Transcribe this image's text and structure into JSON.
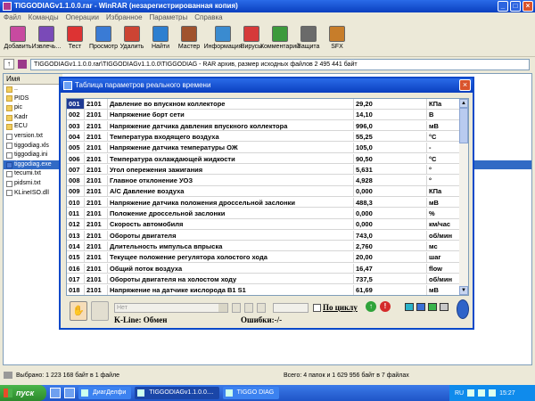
{
  "winrar": {
    "title": "TIGGODIAGv1.1.0.0.rar - WinRAR (незарегистрированная копия)",
    "menu": [
      "Файл",
      "Команды",
      "Операции",
      "Избранное",
      "Параметры",
      "Справка"
    ],
    "toolbar": [
      "Добавить",
      "Извлечь...",
      "Тест",
      "Просмотр",
      "Удалить",
      "Найти",
      "Мастер",
      "Информация",
      "Вирусы",
      "Комментарий",
      "Защита",
      "SFX"
    ],
    "address": "TIGGODIAGv1.1.0.0.rar\\TIGGODIAGv1.1.0.0\\TIGGODIAG - RAR архив, размер исходных файлов 2 495 441 байт",
    "files_header": "Имя",
    "files": [
      {
        "name": "..",
        "type": "folder"
      },
      {
        "name": "PIDS",
        "type": "folder"
      },
      {
        "name": "pic",
        "type": "folder"
      },
      {
        "name": "Kadr",
        "type": "folder"
      },
      {
        "name": "ECU",
        "type": "folder"
      },
      {
        "name": "version.txt",
        "type": "doc"
      },
      {
        "name": "tiggodiag.xls",
        "type": "doc"
      },
      {
        "name": "tiggodiag.ini",
        "type": "doc"
      },
      {
        "name": "tiggodiag.exe",
        "type": "exe",
        "selected": true
      },
      {
        "name": "tecumi.txt",
        "type": "doc"
      },
      {
        "name": "pidsmi.txt",
        "type": "doc"
      },
      {
        "name": "KLineISO.dll",
        "type": "doc"
      }
    ],
    "status_left": "Выбрано: 1 223 168 байт в 1 файле",
    "status_right": "Всего: 4 папок и 1 629 956 байт в 7 файлах"
  },
  "dialog": {
    "title": "Таблица параметров реального времени",
    "rows": [
      {
        "n": "001",
        "code": "2101",
        "name": "Давление во впускном коллекторе",
        "value": "29,20",
        "unit": "КПа"
      },
      {
        "n": "002",
        "code": "2101",
        "name": "Напряжение борт сети",
        "value": "14,10",
        "unit": "В"
      },
      {
        "n": "003",
        "code": "2101",
        "name": "Напряжение датчика давления впускного коллектора",
        "value": "996,0",
        "unit": "мВ"
      },
      {
        "n": "004",
        "code": "2101",
        "name": "Температура входящего воздуха",
        "value": "55,25",
        "unit": "°C"
      },
      {
        "n": "005",
        "code": "2101",
        "name": "Напряжение датчика температуры ОЖ",
        "value": "105,0",
        "unit": "-"
      },
      {
        "n": "006",
        "code": "2101",
        "name": "Температура охлаждающей жидкости",
        "value": "90,50",
        "unit": "°C"
      },
      {
        "n": "007",
        "code": "2101",
        "name": "Угол опережения зажигания",
        "value": "5,631",
        "unit": "°"
      },
      {
        "n": "008",
        "code": "2101",
        "name": "Главное отклонение УОЗ",
        "value": "4,928",
        "unit": "°"
      },
      {
        "n": "009",
        "code": "2101",
        "name": "А/С Давление воздуха",
        "value": "0,000",
        "unit": "КПа"
      },
      {
        "n": "010",
        "code": "2101",
        "name": "Напряжение датчика положения дроссельной заслонки",
        "value": "488,3",
        "unit": "мВ"
      },
      {
        "n": "011",
        "code": "2101",
        "name": "Положение дроссельной заслонки",
        "value": "0,000",
        "unit": "%"
      },
      {
        "n": "012",
        "code": "2101",
        "name": "Скорость автомобиля",
        "value": "0,000",
        "unit": "км/час"
      },
      {
        "n": "013",
        "code": "2101",
        "name": "Обороты двигателя",
        "value": "743,0",
        "unit": "об/мин"
      },
      {
        "n": "014",
        "code": "2101",
        "name": "Длительность импульса впрыска",
        "value": "2,760",
        "unit": "мс"
      },
      {
        "n": "015",
        "code": "2101",
        "name": "Текущее положение регулятора холостого хода",
        "value": "20,00",
        "unit": "шаг"
      },
      {
        "n": "016",
        "code": "2101",
        "name": "Общий поток воздуха",
        "value": "16,47",
        "unit": "flow"
      },
      {
        "n": "017",
        "code": "2101",
        "name": "Обороты двигателя на холостом ходу",
        "value": "737,5",
        "unit": "об/мин"
      },
      {
        "n": "018",
        "code": "2101",
        "name": "Напряжение на датчике кислорода B1 S1",
        "value": "61,69",
        "unit": "мВ"
      }
    ],
    "combo_value": "Нет",
    "cycle_label": "По циклу",
    "kline_label": "K-Line: Обмен",
    "errors_label": "Ошибки:-/-"
  },
  "taskbar": {
    "start_label": "пуск",
    "buttons": [
      "ДиагДелфи",
      "TIGGODIAGv1.1.0.0....",
      "TIGGO DIAG"
    ],
    "lang": "RU",
    "clock": "15:27"
  }
}
